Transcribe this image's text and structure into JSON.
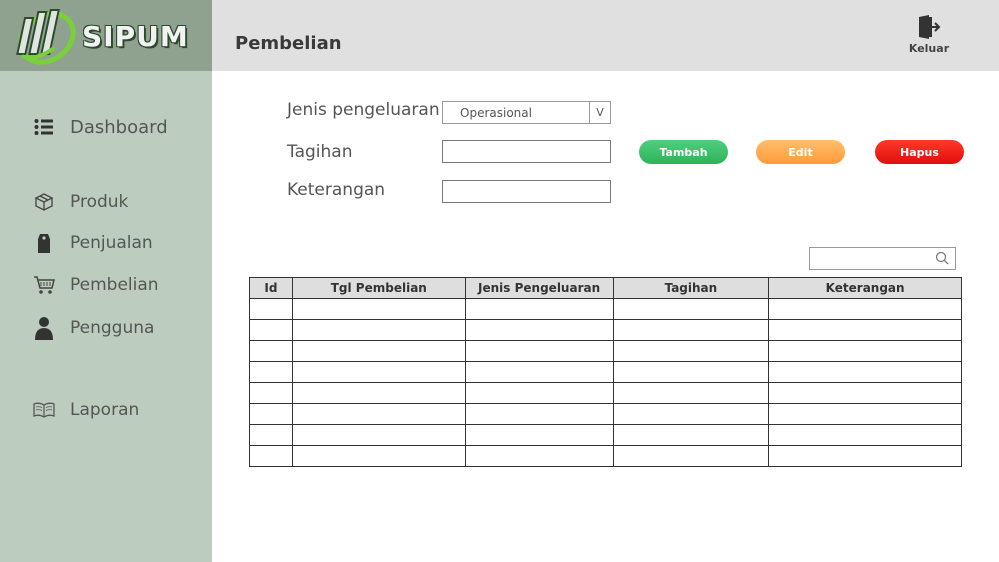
{
  "app": {
    "logo_text": "SIPUM"
  },
  "header": {
    "title": "Pembelian",
    "logout_label": "Keluar",
    "logout_icon": "logout-icon"
  },
  "sidebar": {
    "items": [
      {
        "label": "Dashboard",
        "icon": "list-icon"
      },
      {
        "label": "Produk",
        "icon": "box-icon"
      },
      {
        "label": "Penjualan",
        "icon": "tag-icon"
      },
      {
        "label": "Pembelian",
        "icon": "cart-icon"
      },
      {
        "label": "Pengguna",
        "icon": "user-icon"
      },
      {
        "label": "Laporan",
        "icon": "book-icon"
      }
    ]
  },
  "form": {
    "jenis_label": "Jenis pengeluaran",
    "jenis_value": "Operasional",
    "jenis_arrow": "V",
    "tagihan_label": "Tagihan",
    "tagihan_value": "",
    "keterangan_label": "Keterangan",
    "keterangan_value": ""
  },
  "actions": {
    "add_label": "Tambah",
    "edit_label": "Edit",
    "delete_label": "Hapus"
  },
  "search": {
    "value": "",
    "icon": "search-icon"
  },
  "table": {
    "columns": [
      "Id",
      "Tgl Pembelian",
      "Jenis Pengeluaran",
      "Tagihan",
      "Keterangan"
    ],
    "rows": [
      [
        "",
        "",
        "",
        "",
        ""
      ],
      [
        "",
        "",
        "",
        "",
        ""
      ],
      [
        "",
        "",
        "",
        "",
        ""
      ],
      [
        "",
        "",
        "",
        "",
        ""
      ],
      [
        "",
        "",
        "",
        "",
        ""
      ],
      [
        "",
        "",
        "",
        "",
        ""
      ],
      [
        "",
        "",
        "",
        "",
        ""
      ],
      [
        "",
        "",
        "",
        "",
        ""
      ]
    ]
  },
  "colors": {
    "sidebar_bg": "#bccdbf",
    "logo_bg": "#8fa28f",
    "header_bg": "#e0e0e0",
    "add_button": "#3cc06a",
    "edit_button": "#ffae52",
    "delete_button": "#f0150f"
  }
}
